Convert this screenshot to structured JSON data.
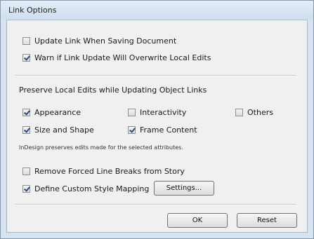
{
  "window": {
    "title": "Link Options"
  },
  "options": {
    "update_on_save": {
      "label": "Update Link When Saving Document",
      "checked": false
    },
    "warn_overwrite": {
      "label": "Warn if Link Update Will Overwrite Local Edits",
      "checked": true
    }
  },
  "preserve": {
    "section_title": "Preserve Local Edits while Updating Object Links",
    "appearance": {
      "label": "Appearance",
      "checked": true
    },
    "interactivity": {
      "label": "Interactivity",
      "checked": false
    },
    "others": {
      "label": "Others",
      "checked": false
    },
    "size_shape": {
      "label": "Size and Shape",
      "checked": true
    },
    "frame_content": {
      "label": "Frame Content",
      "checked": true
    },
    "note": "InDesign preserves edits made for the selected attributes."
  },
  "story": {
    "remove_breaks": {
      "label": "Remove Forced Line Breaks from Story",
      "checked": false
    },
    "custom_style": {
      "label": "Define Custom Style Mapping",
      "checked": true
    },
    "settings_label": "Settings..."
  },
  "buttons": {
    "ok": "OK",
    "reset": "Reset"
  }
}
